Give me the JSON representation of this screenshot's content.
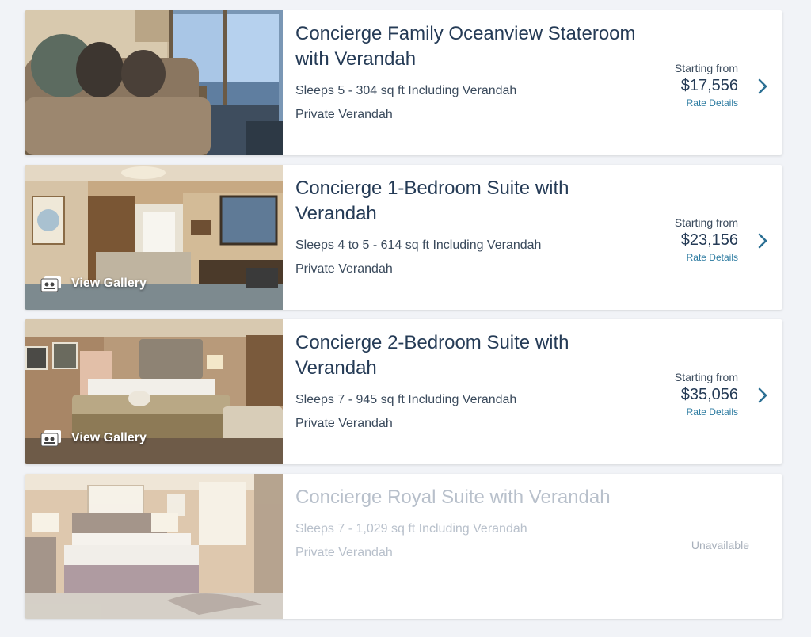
{
  "staterooms": [
    {
      "title": "Concierge Family Oceanview Stateroom with Verandah",
      "details": "Sleeps 5 - 304 sq ft Including Verandah",
      "feature": "Private Verandah",
      "starting_label": "Starting from",
      "price": "$17,556",
      "rate_details": "Rate Details",
      "photo_icon": "living-room-photo"
    },
    {
      "title": "Concierge 1-Bedroom Suite with Verandah",
      "details": "Sleeps 4 to 5 - 614 sq ft Including Verandah",
      "feature": "Private Verandah",
      "starting_label": "Starting from",
      "price": "$23,156",
      "rate_details": "Rate Details",
      "gallery_label": "View Gallery",
      "photo_icon": "suite-living-room-photo"
    },
    {
      "title": "Concierge 2-Bedroom Suite with Verandah",
      "details": "Sleeps 7 - 945 sq ft Including Verandah",
      "feature": "Private Verandah",
      "starting_label": "Starting from",
      "price": "$35,056",
      "rate_details": "Rate Details",
      "gallery_label": "View Gallery",
      "photo_icon": "bedroom-photo"
    },
    {
      "title": "Concierge Royal Suite with Verandah",
      "details": "Sleeps 7 - 1,029 sq ft Including Verandah",
      "feature": "Private Verandah",
      "status": "Unavailable",
      "photo_icon": "royal-bedroom-photo"
    }
  ],
  "colors": {
    "title": "#253b56",
    "link": "#2b7aa0",
    "chevron": "#2b6f93",
    "disabled": "#b8c0cb"
  }
}
